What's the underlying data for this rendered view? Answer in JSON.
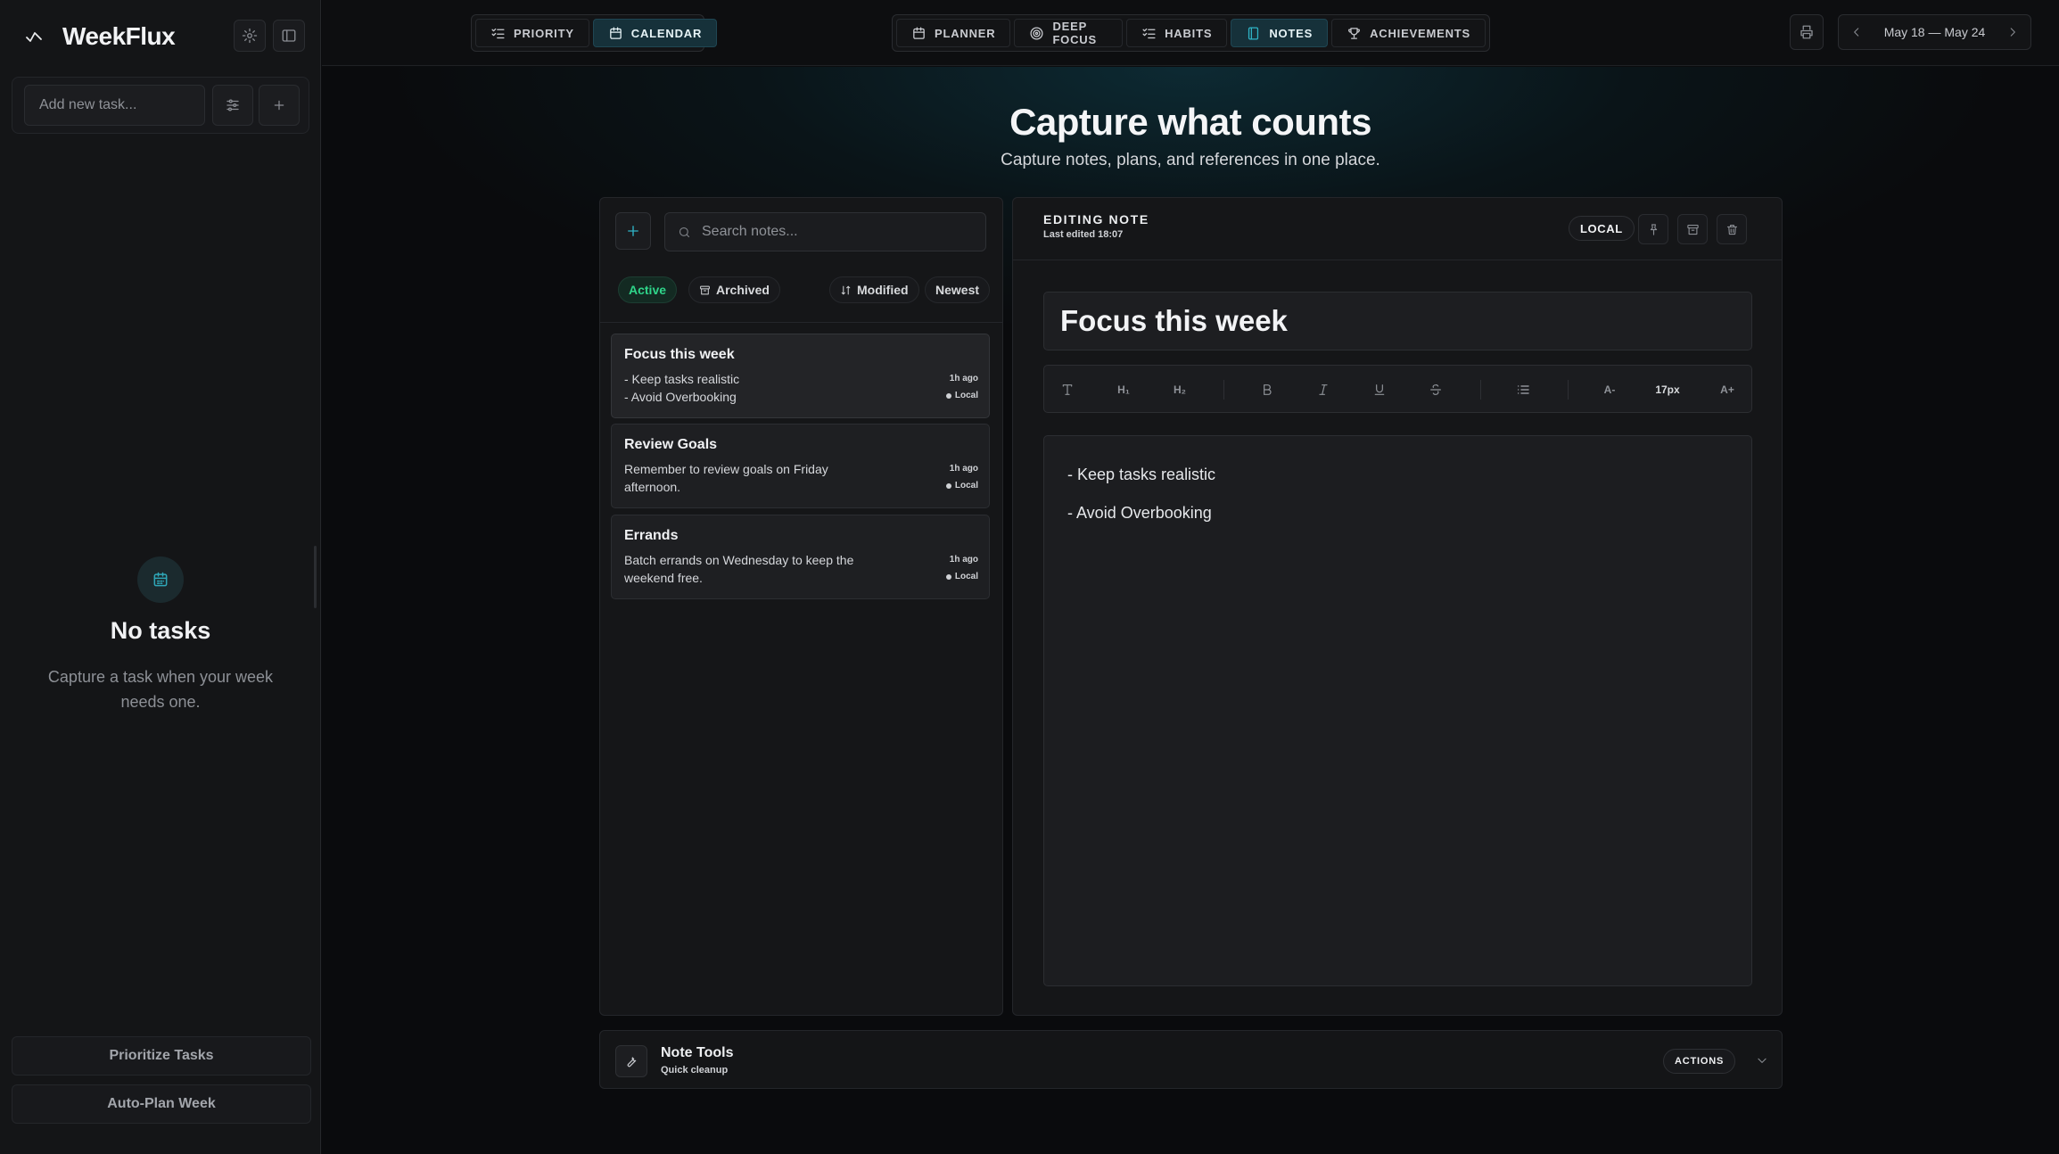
{
  "app": {
    "name": "WeekFlux"
  },
  "sidebar": {
    "add_task_placeholder": "Add new task...",
    "empty_title": "No tasks",
    "empty_text": "Capture a task when your week needs one.",
    "prioritize_label": "Prioritize Tasks",
    "autoplan_label": "Auto-Plan Week"
  },
  "topbar": {
    "view_tabs": [
      {
        "label": "PRIORITY",
        "icon": "list-checks-icon"
      },
      {
        "label": "CALENDAR",
        "icon": "calendar-icon",
        "active": true
      }
    ],
    "mode_tabs": [
      {
        "label": "PLANNER",
        "icon": "calendar-icon"
      },
      {
        "label": "DEEP FOCUS",
        "icon": "target-icon"
      },
      {
        "label": "HABITS",
        "icon": "list-checks-icon"
      },
      {
        "label": "NOTES",
        "icon": "notebook-icon",
        "active": true
      },
      {
        "label": "ACHIEVEMENTS",
        "icon": "trophy-icon"
      }
    ],
    "date_range": "May 18 — May 24"
  },
  "header": {
    "title": "Capture what counts",
    "subtitle": "Capture notes, plans, and references in one place."
  },
  "notes_list": {
    "search_placeholder": "Search notes...",
    "filter_active": "Active",
    "filter_archived": "Archived",
    "sort_field": "Modified",
    "sort_order": "Newest",
    "items": [
      {
        "title": "Focus this week",
        "preview": "- Keep tasks realistic\n- Avoid Overbooking",
        "time": "1h ago",
        "storage": "Local",
        "selected": true
      },
      {
        "title": "Review Goals",
        "preview": "Remember to review goals on Friday afternoon.",
        "time": "1h ago",
        "storage": "Local"
      },
      {
        "title": "Errands",
        "preview": "Batch errands on Wednesday to keep the weekend free.",
        "time": "1h ago",
        "storage": "Local"
      }
    ]
  },
  "editor": {
    "label": "EDITING NOTE",
    "last_edited": "Last edited 18:07",
    "storage_badge": "LOCAL",
    "title": "Focus this week",
    "toolbar": {
      "h1": "H₁",
      "h2": "H₂",
      "font_down": "A-",
      "font_size": "17px",
      "font_up": "A+"
    },
    "content_lines": [
      "- Keep tasks realistic",
      "- Avoid Overbooking"
    ]
  },
  "tools": {
    "title": "Note Tools",
    "subtitle": "Quick cleanup",
    "actions_label": "ACTIONS"
  },
  "colors": {
    "accent": "#2fb4c6",
    "active_green": "#2fd58a",
    "background": "#0b0c0e"
  }
}
